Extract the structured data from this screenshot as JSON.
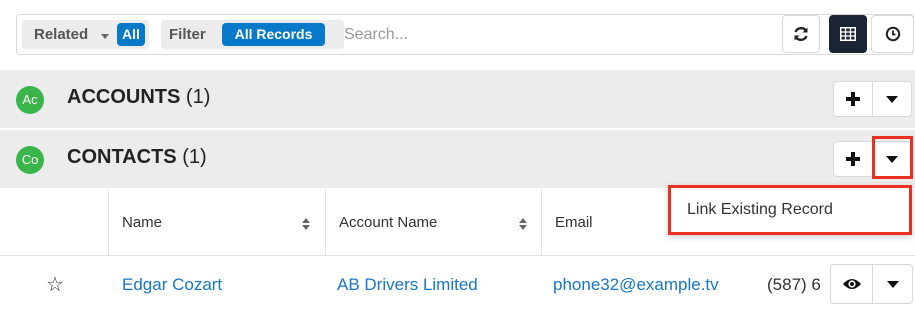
{
  "toolbar": {
    "related_label": "Related",
    "related_value": "All",
    "filter_label": "Filter",
    "filter_value": "All Records",
    "search_placeholder": "Search...",
    "refresh_icon": "refresh-icon",
    "list_view_icon": "list-view-icon",
    "activity_stream_icon": "clock-icon"
  },
  "panels": [
    {
      "avatar": "Ac",
      "title": "ACCOUNTS",
      "count": "(1)",
      "color": "#3ab54a"
    },
    {
      "avatar": "Co",
      "title": "CONTACTS",
      "count": "(1)",
      "color": "#3ab54a"
    }
  ],
  "table": {
    "columns": [
      "Name",
      "Account Name",
      "Email"
    ],
    "rows": [
      {
        "name": "Edgar Cozart",
        "account": "AB Drivers Limited",
        "email": "phone32@example.tv",
        "phone": "(587) 6"
      }
    ]
  },
  "menu": {
    "items": [
      "Link Existing Record"
    ]
  },
  "colors": {
    "accent": "#0679c8",
    "link": "#1777c8",
    "highlight": "#e8321f",
    "panel_bg": "#ececec"
  }
}
